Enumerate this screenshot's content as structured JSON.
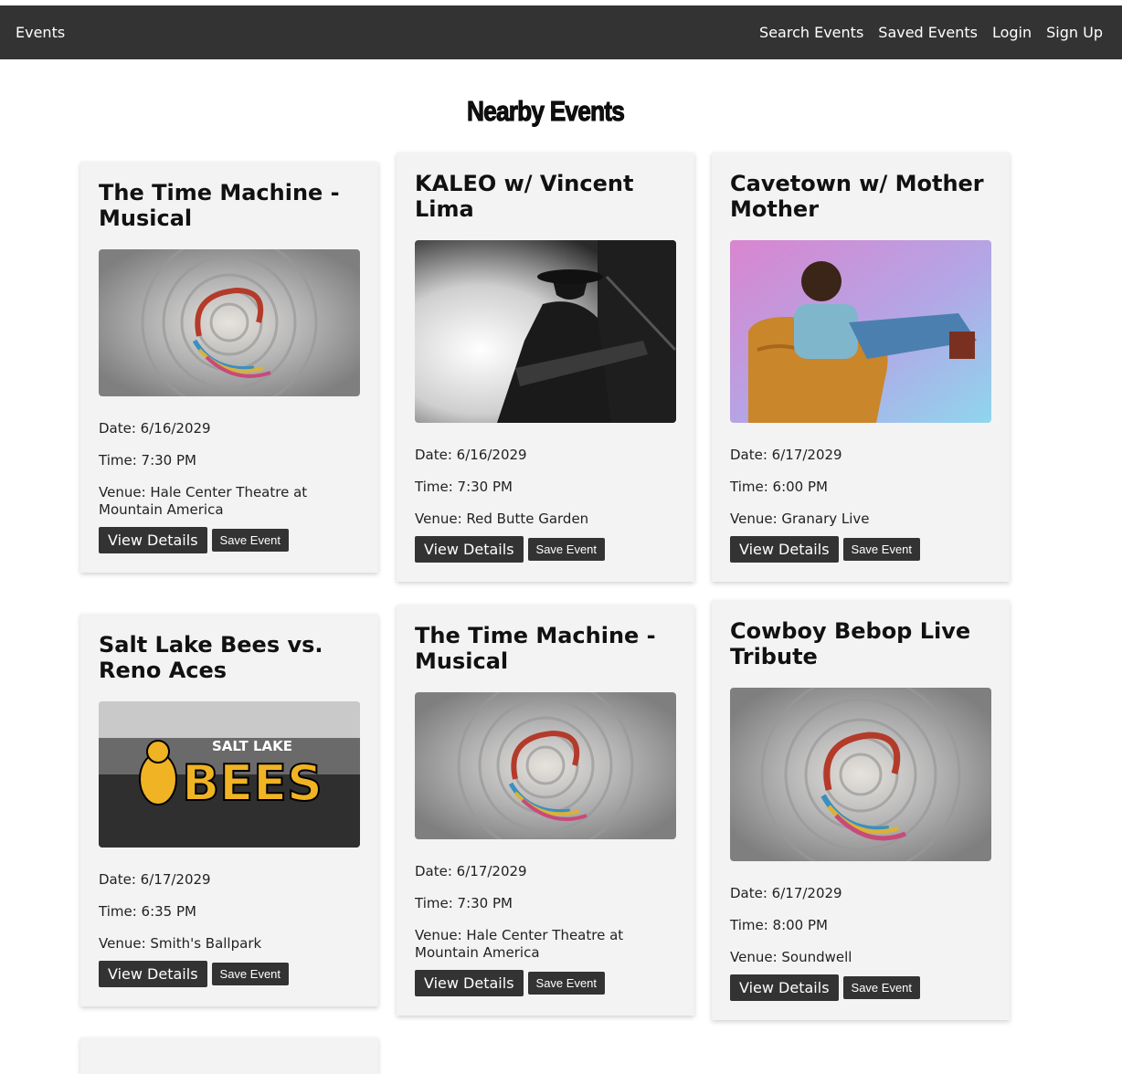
{
  "nav": {
    "brand": "Events",
    "links": [
      "Search Events",
      "Saved Events",
      "Login",
      "Sign Up"
    ]
  },
  "page_title": "Nearby Events",
  "events": [
    {
      "title": "The Time Machine - Musical",
      "image": "swirl",
      "date": "Date: 6/16/2029",
      "time": "Time: 7:30 PM",
      "venue": "Venue: Hale Center Theatre at Mountain America",
      "view_label": "View Details",
      "save_label": "Save Event"
    },
    {
      "title": "KALEO w/ Vincent Lima",
      "image": "guitarist",
      "date": "Date: 6/16/2029",
      "time": "Time: 7:30 PM",
      "venue": "Venue: Red Butte Garden",
      "view_label": "View Details",
      "save_label": "Save Event"
    },
    {
      "title": "Cavetown w/ Mother Mother",
      "image": "artist-on-chair",
      "date": "Date: 6/17/2029",
      "time": "Time: 6:00 PM",
      "venue": "Venue: Granary Live",
      "view_label": "View Details",
      "save_label": "Save Event"
    },
    {
      "title": "Salt Lake Bees vs. Reno Aces",
      "image": "bees-logo",
      "logo_text_top": "SALT LAKE",
      "logo_text_main": "BEES",
      "date": "Date: 6/17/2029",
      "time": "Time: 6:35 PM",
      "venue": "Venue: Smith's Ballpark",
      "view_label": "View Details",
      "save_label": "Save Event"
    },
    {
      "title": "The Time Machine - Musical",
      "image": "swirl",
      "date": "Date: 6/17/2029",
      "time": "Time: 7:30 PM",
      "venue": "Venue: Hale Center Theatre at Mountain America",
      "view_label": "View Details",
      "save_label": "Save Event"
    },
    {
      "title": "Cowboy Bebop Live Tribute",
      "image": "swirl",
      "date": "Date: 6/17/2029",
      "time": "Time: 8:00 PM",
      "venue": "Venue: Soundwell",
      "view_label": "View Details",
      "save_label": "Save Event"
    }
  ]
}
